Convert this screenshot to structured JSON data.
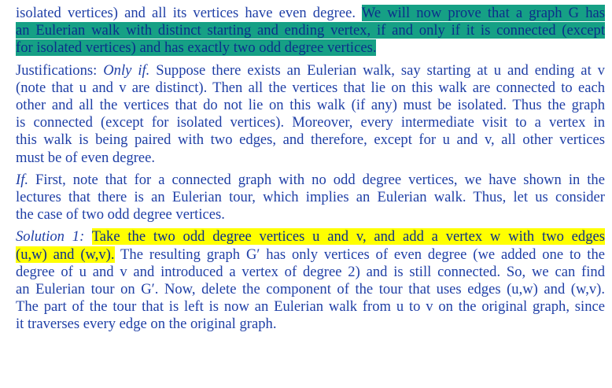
{
  "p1": {
    "l1_a": "isolated vertices) and all its vertices have even degree. ",
    "l1_b": "We will now prove that a graph G has",
    "l2": "an Eulerian walk with distinct starting and ending vertex, if and only if it is connected (except",
    "l3": "for isolated vertices) and has exactly two odd degree vertices."
  },
  "p2": {
    "l1_a": "Justifications: ",
    "l1_b": "Only if.",
    "l1_c": " Suppose there exists an Eulerian walk, say starting at u and ending at v",
    "l2": "(note that u and v are distinct). Then all the vertices that lie on this walk are connected to each",
    "l3": "other and all the vertices that do not lie on this walk (if any) must be isolated. Thus the graph",
    "l4": "is connected (except for isolated vertices). Moreover, every intermediate visit to a vertex in",
    "l5": "this walk is being paired with two edges, and therefore, except for u and v, all other vertices",
    "l6": "must be of even degree."
  },
  "p3": {
    "l1_a": "If.",
    "l1_b": " First, note that for a connected graph with no odd degree vertices, we have shown in the",
    "l2": "lectures that there is an Eulerian tour, which implies an Eulerian walk. Thus, let us consider",
    "l3": "the case of two odd degree vertices."
  },
  "p4": {
    "l1_a": "Solution 1:",
    "l1_b": "Take the two odd degree vertices u and v, and add a vertex w with two edges",
    "l2_a": "(u,w) and (w,v).",
    "l2_b": " The resulting graph G′ has only vertices of even degree (we added one to the",
    "l3": "degree of u and v and introduced a vertex of degree 2) and is still connected. So, we can find",
    "l4": "an Eulerian tour on G′. Now, delete the component of the tour that uses edges (u,w) and (w,v).",
    "l5": "The part of the tour that is left is now an Eulerian walk from u to v on the original graph, since",
    "l6": "it traverses every edge on the original graph."
  },
  "colors": {
    "text": "#1f3fa6",
    "highlight_teal": "#16a085",
    "highlight_yellow": "#ffff00"
  }
}
